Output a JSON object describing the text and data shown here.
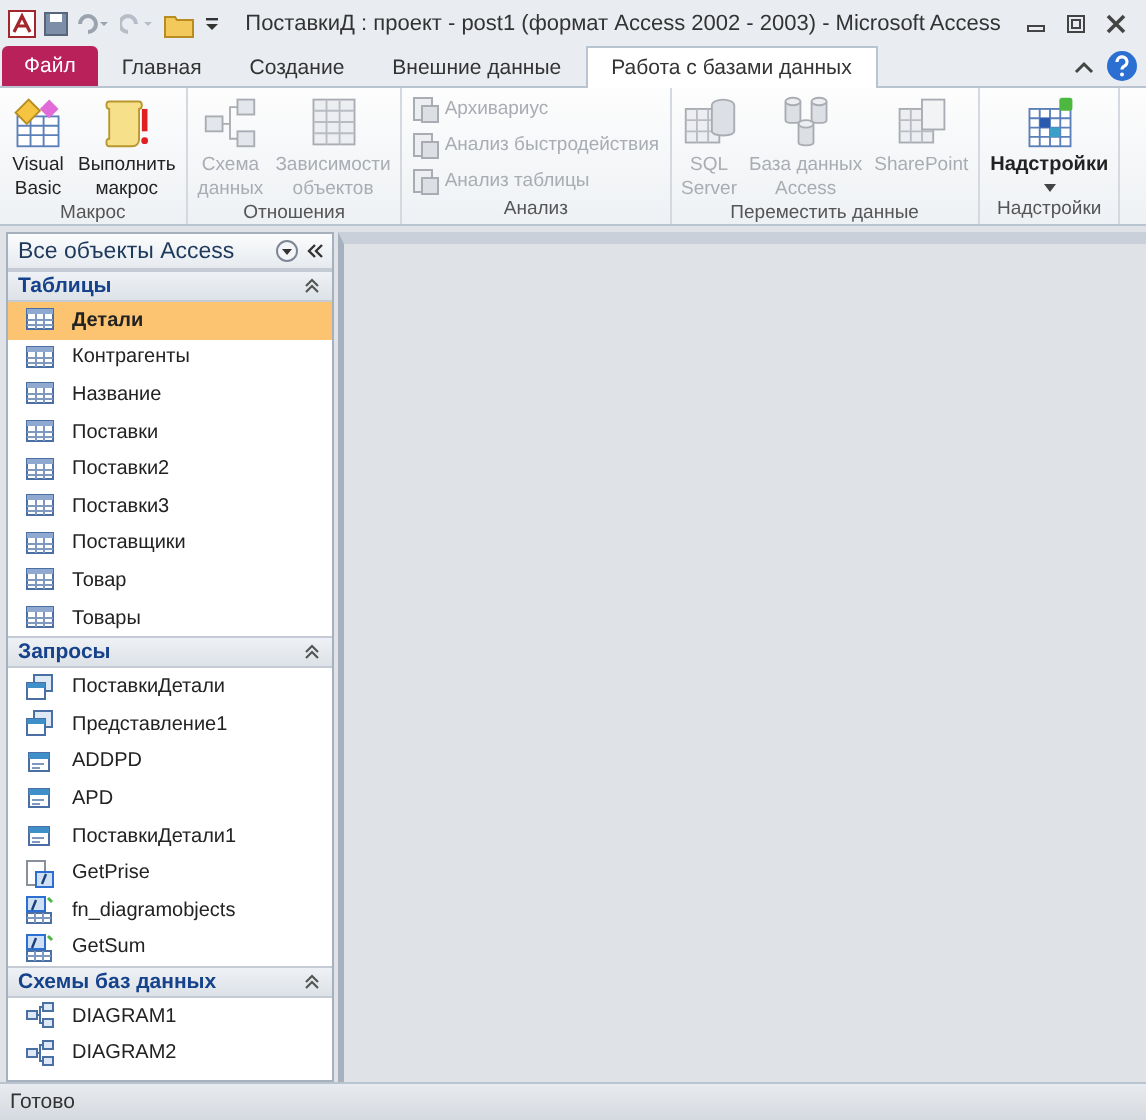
{
  "window": {
    "title": "ПоставкиД : проект - post1 (формат Access 2002 - 2003)  -  Microsoft Access"
  },
  "tabs": [
    {
      "label": "Файл",
      "kind": "file",
      "selected": false
    },
    {
      "label": "Главная",
      "kind": "normal",
      "selected": false
    },
    {
      "label": "Создание",
      "kind": "normal",
      "selected": false
    },
    {
      "label": "Внешние данные",
      "kind": "normal",
      "selected": false
    },
    {
      "label": "Работа с базами данных",
      "kind": "normal",
      "selected": true
    }
  ],
  "ribbon": {
    "groups": [
      {
        "label": "Макрос",
        "buttons": [
          {
            "lines": [
              "Visual",
              "Basic"
            ],
            "kind": "large",
            "disabled": false
          },
          {
            "lines": [
              "Выполнить",
              "макрос"
            ],
            "kind": "large",
            "disabled": false
          }
        ]
      },
      {
        "label": "Отношения",
        "buttons": [
          {
            "lines": [
              "Схема",
              "данных"
            ],
            "kind": "large",
            "disabled": true
          },
          {
            "lines": [
              "Зависимости",
              "объектов"
            ],
            "kind": "large",
            "disabled": true
          }
        ]
      },
      {
        "label": "Анализ",
        "buttons": [
          {
            "lines": [
              "Архивариус"
            ],
            "kind": "small",
            "disabled": true
          },
          {
            "lines": [
              "Анализ быстродействия"
            ],
            "kind": "small",
            "disabled": true
          },
          {
            "lines": [
              "Анализ таблицы"
            ],
            "kind": "small",
            "disabled": true
          }
        ]
      },
      {
        "label": "Переместить данные",
        "buttons": [
          {
            "lines": [
              "SQL",
              "Server"
            ],
            "kind": "large",
            "disabled": true
          },
          {
            "lines": [
              "База данных",
              "Access"
            ],
            "kind": "large",
            "disabled": true
          },
          {
            "lines": [
              "SharePoint"
            ],
            "kind": "large",
            "disabled": true
          }
        ]
      },
      {
        "label": "Надстройки",
        "buttons": [
          {
            "lines": [
              "Надстройки"
            ],
            "kind": "menu",
            "disabled": false
          }
        ]
      }
    ]
  },
  "nav": {
    "title": "Все объекты Access",
    "sections": [
      {
        "header": "Таблицы",
        "items": [
          {
            "label": "Детали",
            "kind": "table",
            "selected": true
          },
          {
            "label": "Контрагенты",
            "kind": "table",
            "selected": false
          },
          {
            "label": "Название",
            "kind": "table",
            "selected": false
          },
          {
            "label": "Поставки",
            "kind": "table",
            "selected": false
          },
          {
            "label": "Поставки2",
            "kind": "table",
            "selected": false
          },
          {
            "label": "Поставки3",
            "kind": "table",
            "selected": false
          },
          {
            "label": "Поставщики",
            "kind": "table",
            "selected": false
          },
          {
            "label": "Товар",
            "kind": "table",
            "selected": false
          },
          {
            "label": "Товары",
            "kind": "table",
            "selected": false
          }
        ]
      },
      {
        "header": "Запросы",
        "items": [
          {
            "label": "ПоставкиДетали",
            "kind": "view",
            "selected": false
          },
          {
            "label": "Представление1",
            "kind": "view",
            "selected": false
          },
          {
            "label": "ADDPD",
            "kind": "proc",
            "selected": false
          },
          {
            "label": "APD",
            "kind": "proc",
            "selected": false
          },
          {
            "label": "ПоставкиДетали1",
            "kind": "proc",
            "selected": false
          },
          {
            "label": "GetPrise",
            "kind": "func",
            "selected": false
          },
          {
            "label": "fn_diagramobjects",
            "kind": "tablefunc",
            "selected": false
          },
          {
            "label": "GetSum",
            "kind": "tablefunc",
            "selected": false
          }
        ]
      },
      {
        "header": "Схемы баз данных",
        "items": [
          {
            "label": "DIAGRAM1",
            "kind": "diagram",
            "selected": false
          },
          {
            "label": "DIAGRAM2",
            "kind": "diagram",
            "selected": false
          }
        ]
      }
    ]
  },
  "status_bar": {
    "text": "Готово"
  }
}
